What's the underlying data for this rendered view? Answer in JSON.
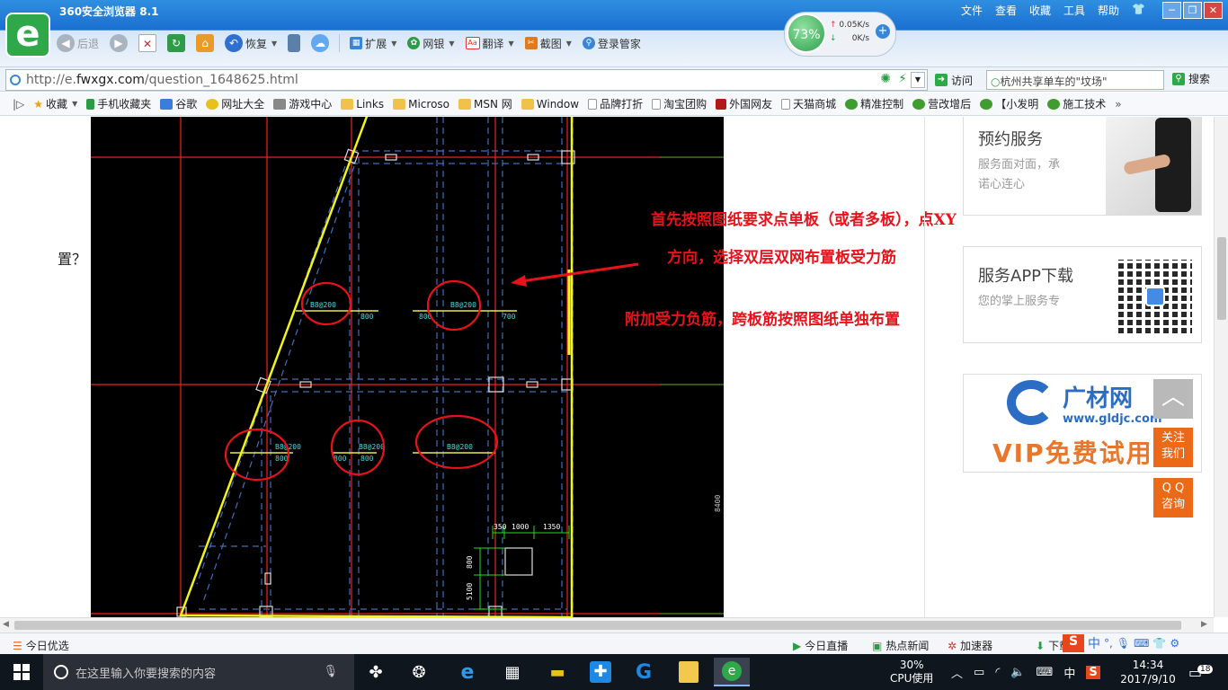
{
  "browser": {
    "title": "360安全浏览器 8.1",
    "menu": [
      "文件",
      "查看",
      "收藏",
      "工具",
      "帮助"
    ],
    "toolbar": {
      "back": "后退",
      "restore": "恢复",
      "extend": "扩展",
      "bank": "网银",
      "translate": "翻译",
      "screenshot": "截图",
      "login": "登录管家"
    },
    "speed": {
      "percent": "73%",
      "up": "0.05K/s",
      "down": "0K/s"
    },
    "url": {
      "prefix": "http://e.",
      "domain": "fwxgx.com",
      "path": "/question_1648625.html"
    },
    "visit_label": "访问",
    "search_placeholder": "杭州共享单车的\"坟场\"",
    "search_button": "搜索",
    "favorites": [
      "收藏",
      "手机收藏夹",
      "谷歌",
      "网址大全",
      "游戏中心",
      "Links",
      "Microso",
      "MSN 网",
      "Window",
      "品牌打折",
      "淘宝团购",
      "外国网友",
      "天猫商城",
      "精准控制",
      "营改增后",
      "【小发明",
      "施工技术"
    ]
  },
  "page": {
    "question_fragment": "置？",
    "annotations": [
      "首先按照图纸要求点单板（或者多板），点XY",
      "方向，选择双层双网布置板受力筋",
      "附加受力负筋，跨板筋按照图纸单独布置"
    ],
    "cad_labels": {
      "rebar": "8@200",
      "dims": [
        "800",
        "800",
        "700",
        "800",
        "800",
        "800"
      ],
      "dim_top": [
        "350",
        "1000",
        "1350"
      ],
      "dim_side": [
        "800",
        "5100"
      ],
      "right_dim": "8400"
    },
    "sidebar": {
      "service_title": "预约服务",
      "service_sub_1": "服务面对面，承",
      "service_sub_2": "诺心连心",
      "app_title": "服务APP下载",
      "app_sub": "您的掌上服务专",
      "ad_brand": "广材网",
      "ad_url": "www.gldjc.com",
      "ad_vip": "VIP免费试用"
    },
    "float": {
      "follow_1": "关注",
      "follow_2": "我们",
      "qq_1": "Q Q",
      "qq_2": "咨询"
    }
  },
  "statusbar": {
    "left": "今日优选",
    "live": "今日直播",
    "news": "热点新闻",
    "accel": "加速器",
    "download": "下载"
  },
  "taskbar": {
    "search_placeholder": "在这里输入你要搜索的内容",
    "cpu_percent": "30%",
    "cpu_label": "CPU使用",
    "ime": "中",
    "time": "14:34",
    "date": "2017/9/10",
    "notify_count": "18"
  }
}
